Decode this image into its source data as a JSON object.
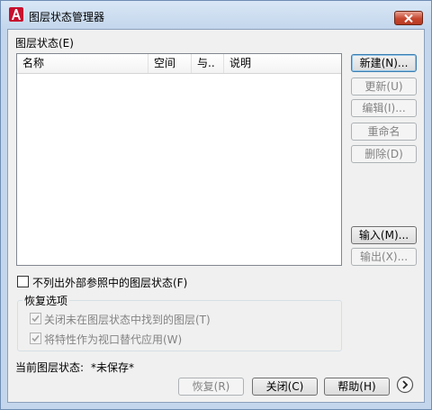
{
  "window": {
    "title": "图层状态管理器",
    "icon": "autocad-icon",
    "close_icon": "close-icon"
  },
  "layer_states_label": "图层状态(E)",
  "list": {
    "columns": [
      "名称",
      "空间",
      "与..",
      "说明"
    ],
    "rows": []
  },
  "buttons": {
    "new": "新建(N)...",
    "update": "更新(U)",
    "edit": "编辑(I)...",
    "rename": "重命名",
    "delete": "删除(D)",
    "import": "输入(M)...",
    "export": "输出(X)...",
    "restore": "恢复(R)",
    "close": "关闭(C)",
    "help": "帮助(H)"
  },
  "options": {
    "exclude_xref": "不列出外部参照中的图层状态(F)",
    "restore_group_title": "恢复选项",
    "turn_off_not_found": "关闭未在图层状态中找到的图层(T)",
    "apply_as_viewport_override": "将特性作为视口替代应用(W)"
  },
  "current_state": {
    "label": "当前图层状态:",
    "value": "*未保存*"
  },
  "colors": {
    "accent": "#c7462e",
    "window_frame": "#c3d6ec",
    "disabled_text": "#838383"
  }
}
